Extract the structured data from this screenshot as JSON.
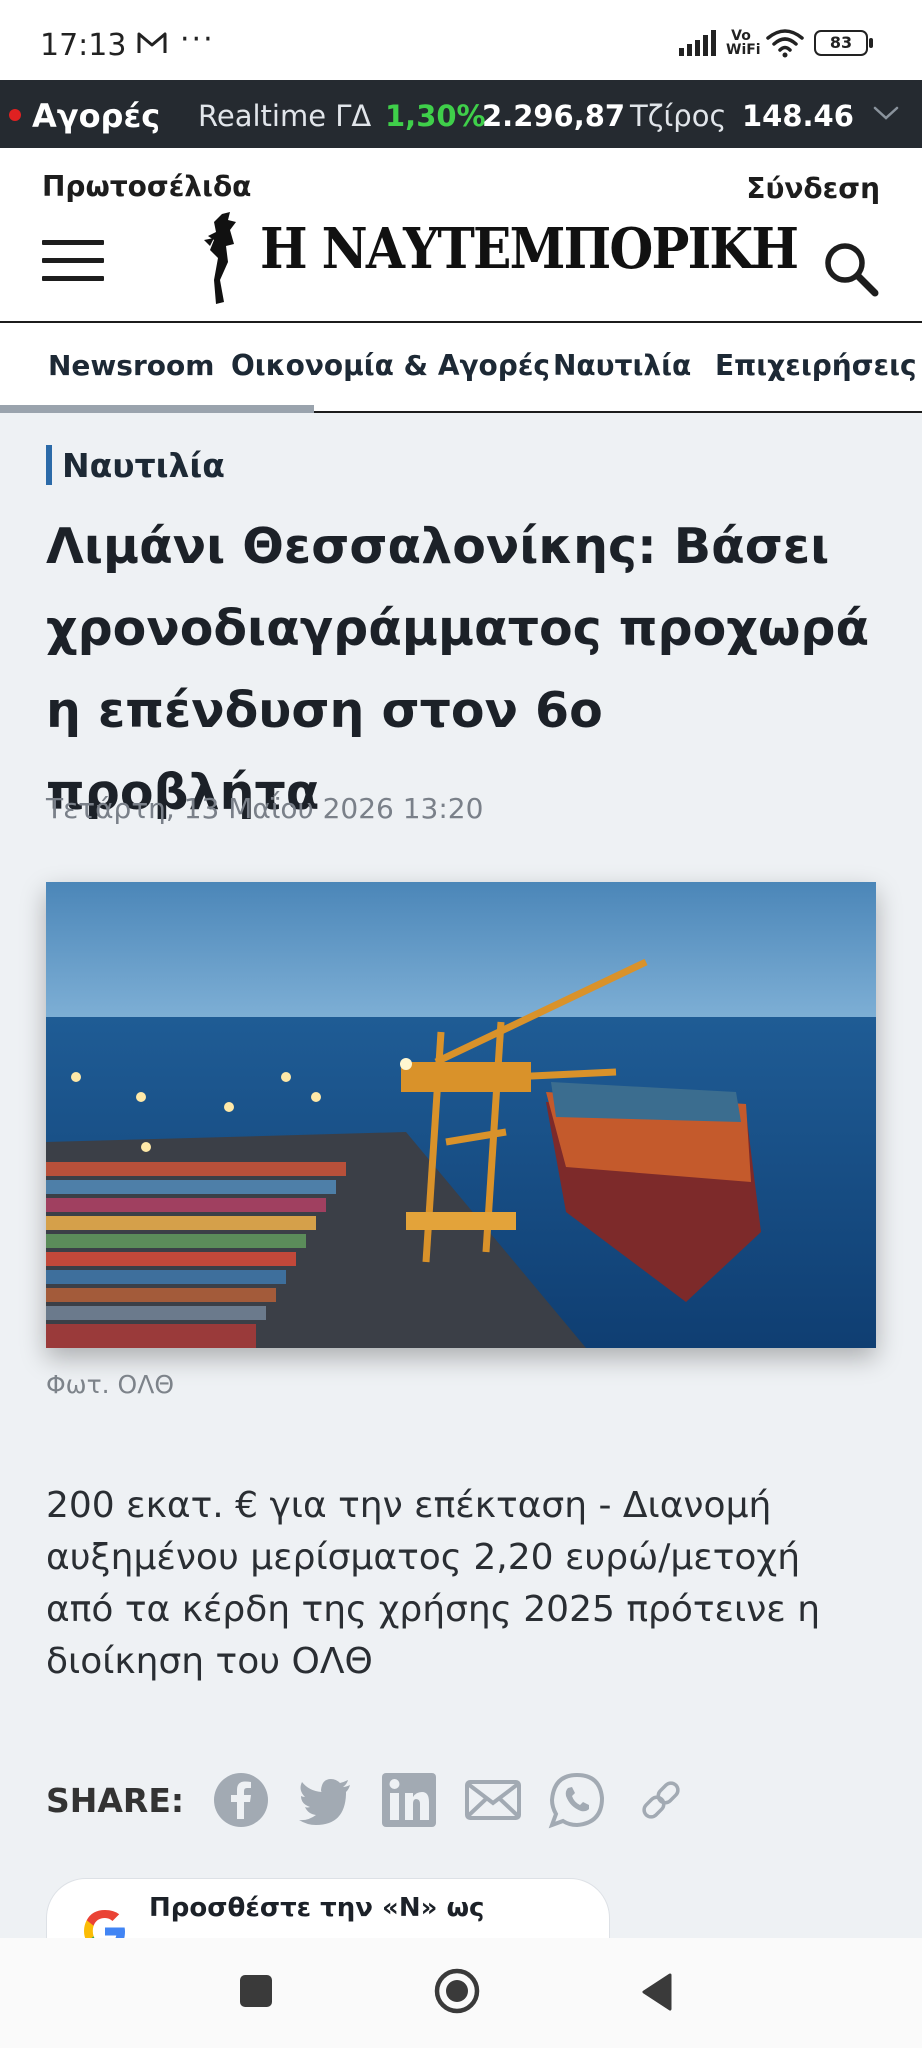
{
  "status_bar": {
    "time": "17:13",
    "dots": "···",
    "network": "Vo WiFi",
    "battery": "83",
    "icons": [
      "mail-icon",
      "signal-icon",
      "wifi-icon",
      "battery-icon"
    ]
  },
  "ticker": {
    "markets_label": "Αγορές",
    "index_label": "Realtime ΓΔ",
    "index_change": "1,30%",
    "index_value": "2.296,87",
    "turnover_label": "Τζίρος",
    "turnover_value": "148.46",
    "colors": {
      "positive": "#3fcf4a",
      "live_dot": "#e02121"
    }
  },
  "header": {
    "front_pages": "Πρωτοσέλιδα",
    "login": "Σύνδεση",
    "logo_text": "Η ΝΑΥΤΕΜΠΟΡΙΚΗ"
  },
  "nav": {
    "items": [
      "Newsroom",
      "Οικονομία & Αγορές",
      "Ναυτιλία",
      "Επιχειρήσεις"
    ]
  },
  "article": {
    "category": "Ναυτιλία",
    "title": "Λιμάνι Θεσσαλονίκης: Βάσει χρονοδιαγράμματος προχωρά η επένδυση στον 6ο προβλήτα",
    "date": "Τετάρτη, 13 Μαΐου 2026 13:20",
    "photo_caption": "Φωτ. ΟΛΘ",
    "lead": "200 εκατ. € για την επέκταση - Διανομή αυξημένου μερίσματος 2,20 ευρώ/μετοχή από τα κέρδη της χρήσης 2025 πρότεινε η διοίκηση του ΟΛΘ"
  },
  "share": {
    "label": "SHARE:",
    "icons": [
      "facebook-icon",
      "twitter-icon",
      "linkedin-icon",
      "email-icon",
      "whatsapp-icon",
      "link-icon"
    ]
  },
  "google_box": {
    "text": "Προσθέστε την «Ν» ως"
  }
}
